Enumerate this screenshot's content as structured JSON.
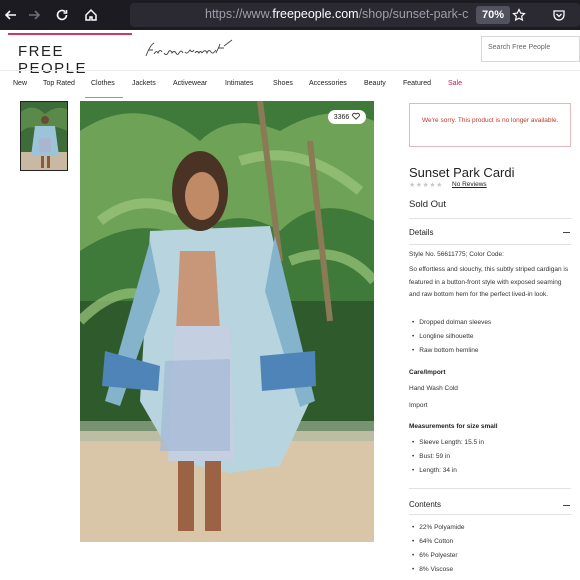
{
  "browser": {
    "url_prefix": "https://www.",
    "url_host": "freepeople.com",
    "url_path": "/shop/sunset-park-card",
    "zoom": "70%"
  },
  "header": {
    "logo": "FREE PEOPLE",
    "search_placeholder": "Search Free People"
  },
  "nav": [
    "New",
    "Top Rated",
    "Clothes",
    "Jackets",
    "Activewear",
    "Intimates",
    "Shoes",
    "Accessories",
    "Beauty",
    "Featured",
    "Sale"
  ],
  "gallery": {
    "likes": "3366"
  },
  "product": {
    "alert": "We're sorry. This product is no longer available.",
    "title": "Sunset Park Cardi",
    "stars": "★★★★★",
    "reviews": "No Reviews",
    "status": "Sold Out",
    "details_heading": "Details",
    "style_no": "Style No. 56611775; Color Code:",
    "description": "So effortless and slouchy, this subtly striped cardigan is featured in a button-front style with exposed seaming and raw bottom hem for the perfect lived-in look.",
    "features": [
      "Dropped dolman sleeves",
      "Longline silhouette",
      "Raw bottom hemline"
    ],
    "care_heading": "Care/Import",
    "care": "Hand Wash Cold",
    "import": "Import",
    "measure_heading": "Measurements for size small",
    "measurements": [
      "Sleeve Length: 15.5 in",
      "Bust: 59 in",
      "Length: 34 in"
    ],
    "contents_heading": "Contents",
    "contents": [
      "22% Polyamide",
      "64% Cotton",
      "6% Polyester",
      "8% Viscose"
    ]
  },
  "colors": {
    "accent": "#d1356c",
    "sale": "#c6195c",
    "alert": "#c0392b"
  }
}
